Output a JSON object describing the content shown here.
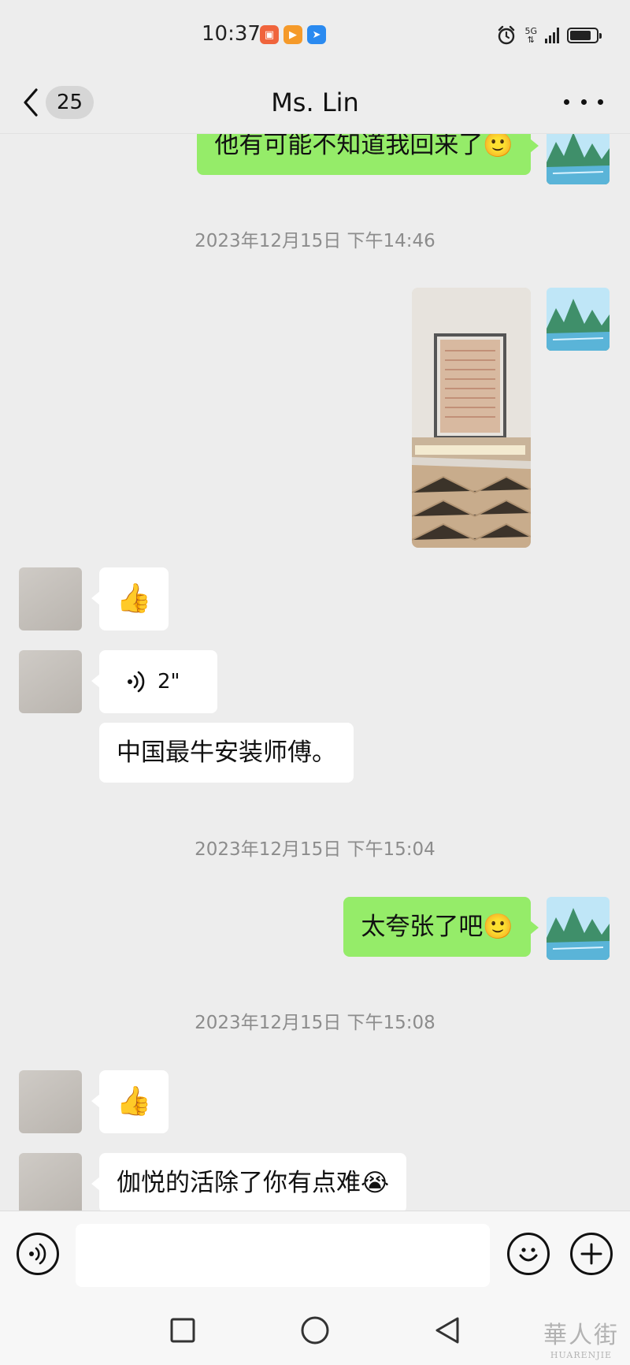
{
  "status_bar": {
    "time": "10:37",
    "network": "5G",
    "app_badges": [
      {
        "name": "video-app-icon",
        "color": "#f0643c",
        "glyph": "88"
      },
      {
        "name": "play-app-icon",
        "color": "#f59a2a",
        "glyph": "▶"
      },
      {
        "name": "flag-app-icon",
        "color": "#2a8af0",
        "glyph": "➤"
      }
    ]
  },
  "header": {
    "unread_count": "25",
    "title": "Ms. Lin"
  },
  "messages": {
    "m1_text": "他有可能不知道我回来了🙂",
    "ts1": "2023年12月15日 下午14:46",
    "m3_emoji": "👍",
    "m4_voice_duration": "2\"",
    "m5_text": "中国最牛安装师傅。",
    "ts2": "2023年12月15日 下午15:04",
    "m6_text": "太夸张了吧🙂",
    "ts3": "2023年12月15日 下午15:08",
    "m7_emoji": "👍",
    "m8_text": "伽悦的活除了你有点难😭"
  },
  "watermark": {
    "cn": "華人街",
    "en": "HUARENJIE"
  },
  "colors": {
    "my_bubble": "#95ec69",
    "other_bubble": "#ffffff",
    "background": "#ededed"
  }
}
